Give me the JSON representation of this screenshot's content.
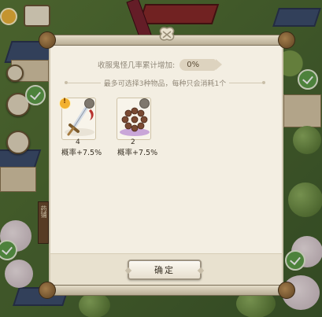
{
  "hud": {
    "signpost_text": "药铺",
    "side_icons": [
      "scroll-icon",
      "book-icon",
      "vase-icon"
    ]
  },
  "dialog": {
    "stat_label": "收服鬼怪几率累计增加:",
    "stat_value": "0%",
    "hint": "最多可选择3种物品，每种只会消耗1个",
    "items": [
      {
        "name": "sword",
        "icon": "sword-icon",
        "count": "4",
        "rate": "概率+7.5%"
      },
      {
        "name": "prayer-beads",
        "icon": "prayer-beads-icon",
        "count": "2",
        "rate": "概率+7.5%"
      }
    ],
    "confirm_label": "确定"
  },
  "colors": {
    "paper": "#f3eee2",
    "badge": "#f2b130",
    "sword_ribbon": "#b8322e",
    "beads": "#7a4a32",
    "beads_plate": "#c9a6d8"
  }
}
